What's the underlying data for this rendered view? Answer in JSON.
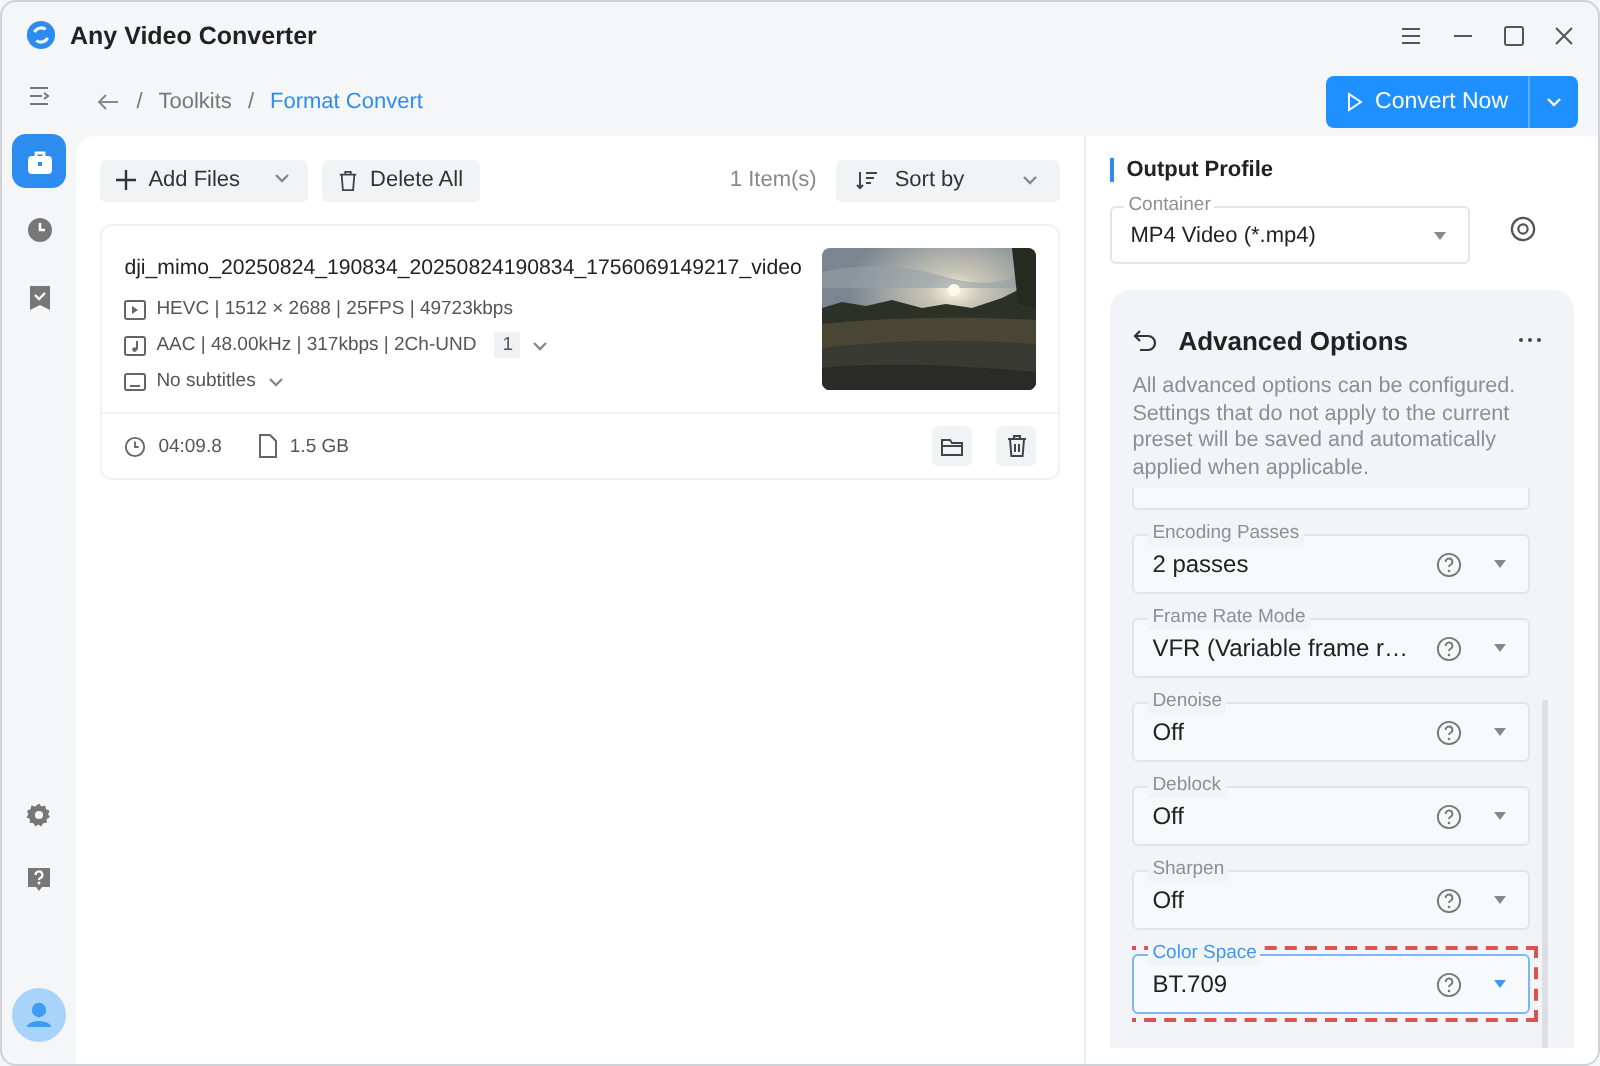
{
  "window": {
    "title": "Any Video Converter"
  },
  "sidebar": {
    "items": [
      {
        "kind": "toolkits",
        "selected": true
      },
      {
        "kind": "history",
        "selected": false
      },
      {
        "kind": "tasks",
        "selected": false
      }
    ]
  },
  "breadcrumb": [
    {
      "separator": "/",
      "label": "Toolkits",
      "current": false
    },
    {
      "separator": "/",
      "label": "Format Convert",
      "current": true
    }
  ],
  "convert_button": {
    "label": "Convert Now"
  },
  "toolbar": {
    "add_files": "Add Files",
    "delete_all": "Delete All",
    "item_count": "1 Item(s)",
    "sort": "Sort by"
  },
  "files": [
    {
      "name": "dji_mimo_20250824_190834_20250824190834_1756069149217_video",
      "video": "HEVC | 1512 × 2688 | 25FPS | 49723kbps",
      "audio": "AAC | 48.00kHz | 317kbps | 2Ch-UND",
      "audio_track": "1",
      "subtitles": "No subtitles",
      "duration": "04:09.8",
      "size": "1.5 GB"
    }
  ],
  "output_profile": {
    "title": "Output Profile",
    "container": {
      "label": "Container",
      "value": "MP4 Video (*.mp4)"
    }
  },
  "advanced": {
    "title": "Advanced Options",
    "description": "All advanced options can be configured. Settings that do not apply to the current preset will be saved and automatically applied when applicable.",
    "fields": [
      {
        "label": "Encoding Passes",
        "value": "2 passes",
        "focused": false,
        "highlighted": false
      },
      {
        "label": "Frame Rate Mode",
        "value": "VFR (Variable frame r…",
        "focused": false,
        "highlighted": false
      },
      {
        "label": "Denoise",
        "value": "Off",
        "focused": false,
        "highlighted": false
      },
      {
        "label": "Deblock",
        "value": "Off",
        "focused": false,
        "highlighted": false
      },
      {
        "label": "Sharpen",
        "value": "Off",
        "focused": false,
        "highlighted": false
      },
      {
        "label": "Color Space",
        "value": "BT.709",
        "focused": true,
        "highlighted": true
      }
    ]
  }
}
